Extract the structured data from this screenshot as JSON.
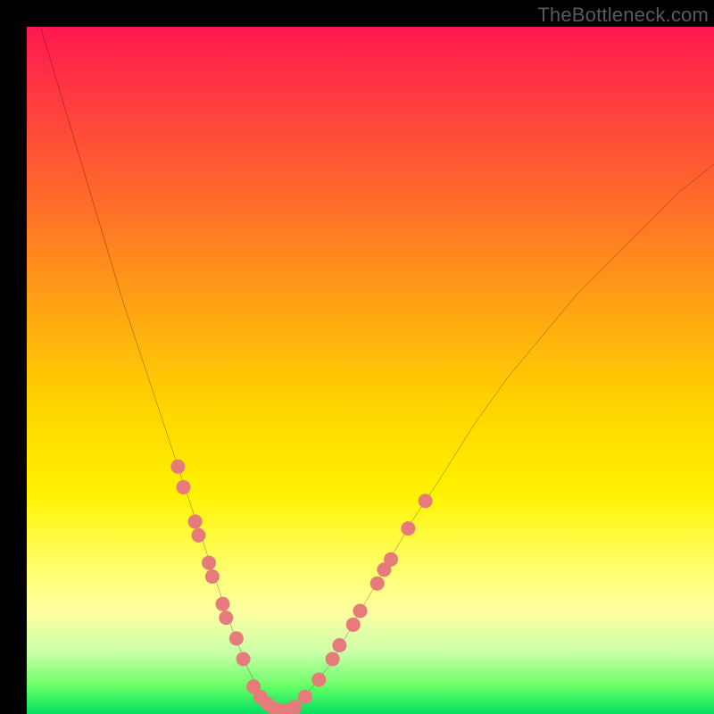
{
  "watermark": "TheBottleneck.com",
  "chart_data": {
    "type": "line",
    "title": "",
    "xlabel": "",
    "ylabel": "",
    "xlim": [
      0,
      100
    ],
    "ylim": [
      0,
      100
    ],
    "grid": false,
    "legend": false,
    "background_gradient": {
      "direction": "vertical",
      "stops": [
        {
          "pos": 0,
          "color": "#ff1850"
        },
        {
          "pos": 10,
          "color": "#ff3a40"
        },
        {
          "pos": 25,
          "color": "#ff6a2a"
        },
        {
          "pos": 40,
          "color": "#ffa114"
        },
        {
          "pos": 55,
          "color": "#ffd400"
        },
        {
          "pos": 68,
          "color": "#fff200"
        },
        {
          "pos": 78,
          "color": "#ffff66"
        },
        {
          "pos": 85,
          "color": "#ffffa0"
        },
        {
          "pos": 91,
          "color": "#ccffaa"
        },
        {
          "pos": 96,
          "color": "#66ff66"
        },
        {
          "pos": 100,
          "color": "#00e060"
        }
      ]
    },
    "series": [
      {
        "name": "bottleneck-curve",
        "color": "#000000",
        "stroke_width": 2,
        "x": [
          2,
          5,
          8,
          11,
          14,
          17,
          20,
          22,
          24,
          26,
          28,
          30,
          32,
          34,
          36,
          38,
          40,
          44,
          48,
          52,
          56,
          60,
          65,
          70,
          75,
          80,
          85,
          90,
          95,
          100
        ],
        "y": [
          100,
          90,
          80,
          70,
          60,
          51,
          42,
          36,
          30,
          24,
          18,
          12,
          7,
          3,
          1,
          0,
          2,
          7,
          14,
          21,
          28,
          34,
          42,
          49,
          55,
          61,
          66,
          71,
          76,
          80
        ]
      }
    ],
    "markers": {
      "name": "highlight-dots",
      "color": "#e77a7a",
      "radius": 8,
      "points": [
        {
          "x": 22.0,
          "y": 36
        },
        {
          "x": 22.8,
          "y": 33
        },
        {
          "x": 24.5,
          "y": 28
        },
        {
          "x": 25.0,
          "y": 26
        },
        {
          "x": 26.5,
          "y": 22
        },
        {
          "x": 27.0,
          "y": 20
        },
        {
          "x": 28.5,
          "y": 16
        },
        {
          "x": 29.0,
          "y": 14
        },
        {
          "x": 30.5,
          "y": 11
        },
        {
          "x": 31.5,
          "y": 8
        },
        {
          "x": 33.0,
          "y": 4
        },
        {
          "x": 34.0,
          "y": 2.5
        },
        {
          "x": 35.0,
          "y": 1.5
        },
        {
          "x": 36.0,
          "y": 0.8
        },
        {
          "x": 37.0,
          "y": 0.5
        },
        {
          "x": 38.0,
          "y": 0.5
        },
        {
          "x": 39.0,
          "y": 1
        },
        {
          "x": 40.5,
          "y": 2.5
        },
        {
          "x": 42.5,
          "y": 5
        },
        {
          "x": 44.5,
          "y": 8
        },
        {
          "x": 45.5,
          "y": 10
        },
        {
          "x": 47.5,
          "y": 13
        },
        {
          "x": 48.5,
          "y": 15
        },
        {
          "x": 51.0,
          "y": 19
        },
        {
          "x": 52.0,
          "y": 21
        },
        {
          "x": 53.0,
          "y": 22.5
        },
        {
          "x": 55.5,
          "y": 27
        },
        {
          "x": 58.0,
          "y": 31
        }
      ]
    }
  }
}
